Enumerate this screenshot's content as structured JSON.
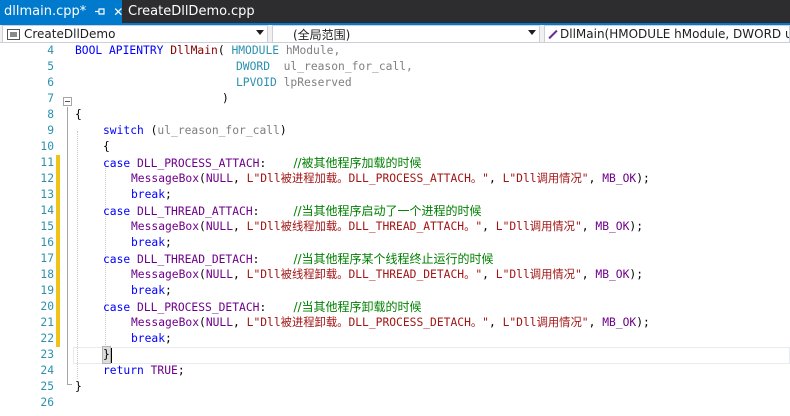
{
  "tabs": [
    {
      "label": "dllmain.cpp*",
      "active": true
    },
    {
      "label": "CreateDllDemo.cpp",
      "active": false
    }
  ],
  "nav": {
    "project": "CreateDllDemo",
    "scope": "(全局范围)",
    "member": "DllMain(HMODULE hModule, DWORD ul_reason_for_call, LPVOID lpReserved)"
  },
  "colors": {
    "accent": "#007acc",
    "line_number": "#2b91af",
    "keyword": "#0000ff",
    "macro": "#6f008a",
    "comment": "#008000",
    "string": "#a31515",
    "change_marker": "#efc318"
  },
  "editor": {
    "lines": [
      {
        "n": "4"
      },
      {
        "n": "5"
      },
      {
        "n": "6"
      },
      {
        "n": "7"
      },
      {
        "n": "8"
      },
      {
        "n": "9"
      },
      {
        "n": "10"
      },
      {
        "n": "11"
      },
      {
        "n": "12"
      },
      {
        "n": "13"
      },
      {
        "n": "14"
      },
      {
        "n": "15"
      },
      {
        "n": "16"
      },
      {
        "n": "17"
      },
      {
        "n": "18"
      },
      {
        "n": "19"
      },
      {
        "n": "20"
      },
      {
        "n": "21"
      },
      {
        "n": "22"
      },
      {
        "n": "23"
      },
      {
        "n": "24"
      },
      {
        "n": "25"
      },
      {
        "n": "26"
      }
    ],
    "tokens": {
      "l4": {
        "a": "BOOL APIENTRY ",
        "b": "DllMain",
        "c": "( ",
        "d": "HMODULE",
        "e": " hModule,"
      },
      "l5": {
        "a": "DWORD",
        "b": "  ul_reason_for_call,"
      },
      "l6": {
        "a": "LPVOID",
        "b": " lpReserved"
      },
      "l7": {
        "a": ")"
      },
      "l8": {
        "a": "{"
      },
      "l9": {
        "a": "switch",
        "b": " (",
        "c": "ul_reason_for_call",
        "d": ")"
      },
      "l10": {
        "a": "{"
      },
      "l11": {
        "a": "case",
        "b": " DLL_PROCESS_ATTACH",
        "c": ":    ",
        "d": "//被其他程序加载的时候"
      },
      "l12": {
        "a": "MessageBox",
        "b": "(",
        "c": "NULL",
        "d": ", ",
        "e": "L\"Dll被进程加载。DLL_PROCESS_ATTACH。\"",
        "f": ", ",
        "g": "L\"Dll调用情况\"",
        "h": ", ",
        "i": "MB_OK",
        "j": ");"
      },
      "l13": {
        "a": "break",
        "b": ";"
      },
      "l14": {
        "a": "case",
        "b": " DLL_THREAD_ATTACH",
        "c": ":     ",
        "d": "//当其他程序启动了一个进程的时候"
      },
      "l15": {
        "a": "MessageBox",
        "b": "(",
        "c": "NULL",
        "d": ", ",
        "e": "L\"Dll被线程加载。DLL_THREAD_ATTACH。\"",
        "f": ", ",
        "g": "L\"Dll调用情况\"",
        "h": ", ",
        "i": "MB_OK",
        "j": ");"
      },
      "l16": {
        "a": "break",
        "b": ";"
      },
      "l17": {
        "a": "case",
        "b": " DLL_THREAD_DETACH",
        "c": ":     ",
        "d": "//当其他程序某个线程终止运行的时候"
      },
      "l18": {
        "a": "MessageBox",
        "b": "(",
        "c": "NULL",
        "d": ", ",
        "e": "L\"Dll被线程卸载。DLL_THREAD_DETACH。\"",
        "f": ", ",
        "g": "L\"Dll调用情况\"",
        "h": ", ",
        "i": "MB_OK",
        "j": ");"
      },
      "l19": {
        "a": "break",
        "b": ";"
      },
      "l20": {
        "a": "case",
        "b": " DLL_PROCESS_DETACH",
        "c": ":    ",
        "d": "//当其他程序卸载的时候"
      },
      "l21": {
        "a": "MessageBox",
        "b": "(",
        "c": "NULL",
        "d": ", ",
        "e": "L\"Dll被进程卸载。DLL_PROCESS_DETACH。\"",
        "f": ", ",
        "g": "L\"Dll调用情况\"",
        "h": ", ",
        "i": "MB_OK",
        "j": ");"
      },
      "l22": {
        "a": "break",
        "b": ";"
      },
      "l23": {
        "a": "}"
      },
      "l24": {
        "a": "return",
        "b": " ",
        "c": "TRUE",
        "d": ";"
      },
      "l25": {
        "a": "}"
      }
    }
  }
}
